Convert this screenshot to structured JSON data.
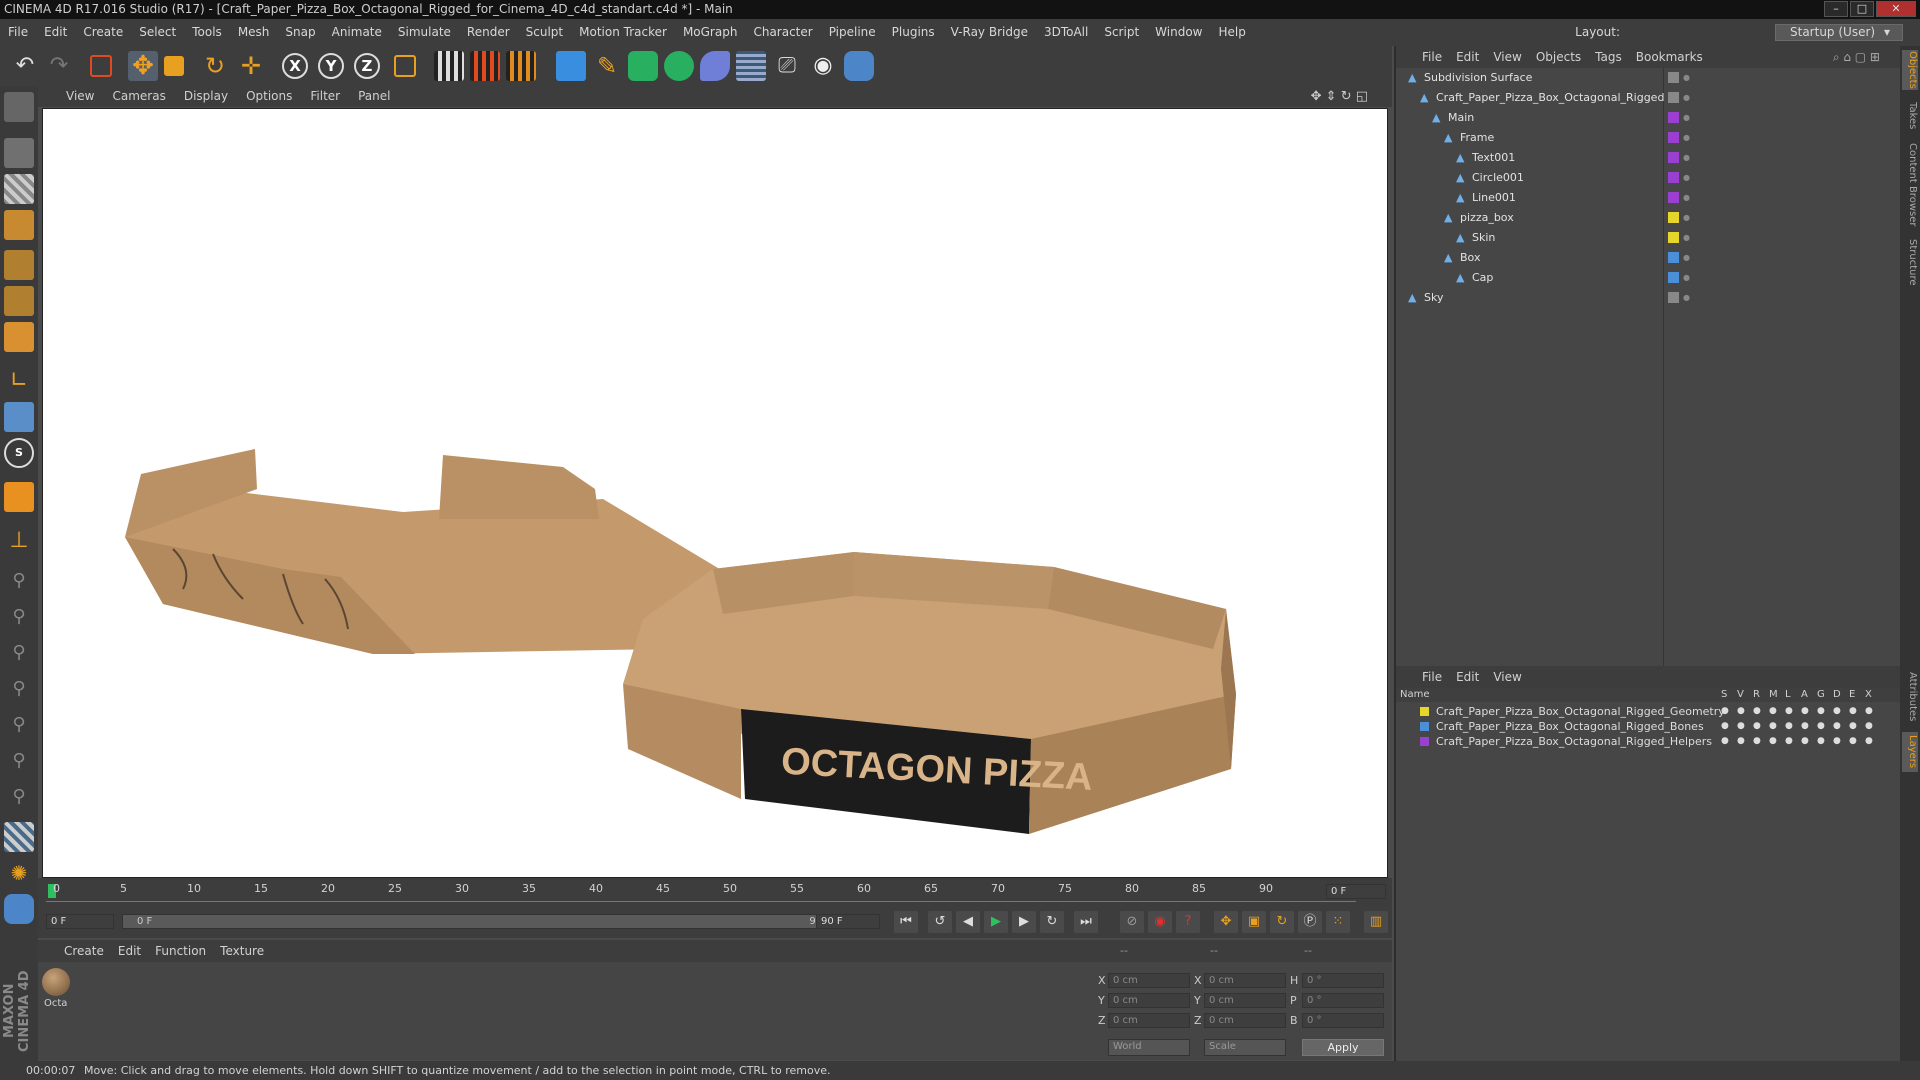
{
  "window": {
    "title": "CINEMA 4D R17.016 Studio (R17) - [Craft_Paper_Pizza_Box_Octagonal_Rigged_for_Cinema_4D_c4d_standart.c4d *] - Main"
  },
  "menu": [
    "File",
    "Edit",
    "Create",
    "Select",
    "Tools",
    "Mesh",
    "Snap",
    "Animate",
    "Simulate",
    "Render",
    "Sculpt",
    "Motion Tracker",
    "MoGraph",
    "Character",
    "Pipeline",
    "Plugins",
    "V-Ray Bridge",
    "3DToAll",
    "Script",
    "Window",
    "Help"
  ],
  "layout": {
    "label": "Layout:",
    "value": "Startup (User)"
  },
  "viewport": {
    "menu": [
      "View",
      "Cameras",
      "Display",
      "Options",
      "Filter",
      "Panel"
    ],
    "box_label": "OCTAGON PIZZA"
  },
  "timeline": {
    "ticks": [
      "0",
      "5",
      "10",
      "15",
      "20",
      "25",
      "30",
      "35",
      "40",
      "45",
      "50",
      "55",
      "60",
      "65",
      "70",
      "75",
      "80",
      "85",
      "90"
    ],
    "current_frame": "0 F",
    "start": "0 F",
    "range_start": "0 F",
    "range_end": "90 F",
    "end": "90 F"
  },
  "material": {
    "menu": [
      "Create",
      "Edit",
      "Function",
      "Texture"
    ],
    "items": [
      {
        "label": "Octa"
      }
    ]
  },
  "coords": {
    "headers": [
      "--",
      "--",
      "--"
    ],
    "rows": [
      {
        "a": "X",
        "a_val": "0 cm",
        "b": "X",
        "b_val": "0 cm",
        "c": "H",
        "c_val": "0 °"
      },
      {
        "a": "Y",
        "a_val": "0 cm",
        "b": "Y",
        "b_val": "0 cm",
        "c": "P",
        "c_val": "0 °"
      },
      {
        "a": "Z",
        "a_val": "0 cm",
        "b": "Z",
        "b_val": "0 cm",
        "c": "B",
        "c_val": "0 °"
      }
    ],
    "mode": "World",
    "type": "Scale",
    "apply": "Apply"
  },
  "objects": {
    "menu": [
      "File",
      "Edit",
      "View",
      "Objects",
      "Tags",
      "Bookmarks"
    ],
    "tree": [
      {
        "label": "Subdivision Surface",
        "indent": 0,
        "color": "#888888"
      },
      {
        "label": "Craft_Paper_Pizza_Box_Octagonal_Rigged",
        "indent": 1,
        "color": "#888888"
      },
      {
        "label": "Main",
        "indent": 2,
        "color": "#9b3fd0"
      },
      {
        "label": "Frame",
        "indent": 3,
        "color": "#9b3fd0"
      },
      {
        "label": "Text001",
        "indent": 4,
        "color": "#9b3fd0"
      },
      {
        "label": "Circle001",
        "indent": 4,
        "color": "#9b3fd0"
      },
      {
        "label": "Line001",
        "indent": 4,
        "color": "#9b3fd0"
      },
      {
        "label": "pizza_box",
        "indent": 3,
        "color": "#e6d52a"
      },
      {
        "label": "Skin",
        "indent": 4,
        "color": "#e6d52a"
      },
      {
        "label": "Box",
        "indent": 3,
        "color": "#4a8fd8"
      },
      {
        "label": "Cap",
        "indent": 4,
        "color": "#4a8fd8"
      },
      {
        "label": "Sky",
        "indent": 0,
        "color": "#888888"
      }
    ]
  },
  "layers": {
    "menu": [
      "File",
      "Edit",
      "View"
    ],
    "columns": {
      "name": "Name",
      "flags": [
        "S",
        "V",
        "R",
        "M",
        "L",
        "A",
        "G",
        "D",
        "E",
        "X"
      ]
    },
    "rows": [
      {
        "label": "Craft_Paper_Pizza_Box_Octagonal_Rigged_Geometry",
        "color": "#e6d52a"
      },
      {
        "label": "Craft_Paper_Pizza_Box_Octagonal_Rigged_Bones",
        "color": "#4a8fd8"
      },
      {
        "label": "Craft_Paper_Pizza_Box_Octagonal_Rigged_Helpers",
        "color": "#9b3fd0"
      }
    ]
  },
  "side_tabs": [
    "Objects",
    "Takes",
    "Content Browser",
    "Structure",
    "Attributes",
    "Layers"
  ],
  "status": {
    "time": "00:00:07",
    "message": "Move: Click and drag to move elements. Hold down SHIFT to quantize movement / add to the selection in point mode, CTRL to remove."
  },
  "brand": "MAXON CINEMA 4D"
}
